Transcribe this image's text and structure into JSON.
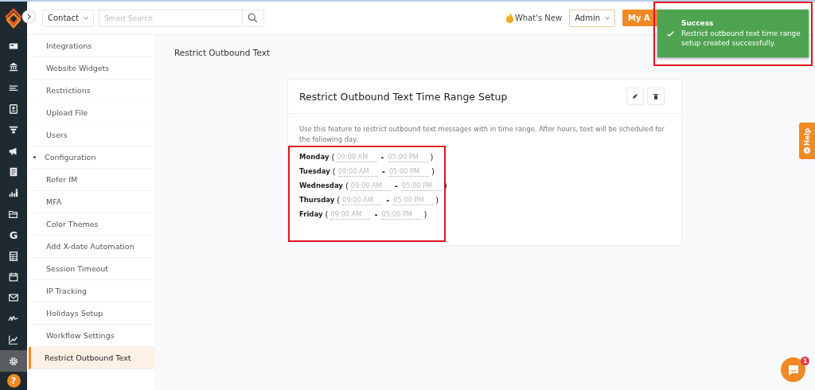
{
  "rail": {
    "items": [
      {
        "kind": "id-card",
        "selected": false
      },
      {
        "kind": "bank",
        "selected": false
      },
      {
        "kind": "list",
        "selected": false
      },
      {
        "kind": "contact",
        "selected": false
      },
      {
        "kind": "funnel",
        "selected": false
      },
      {
        "kind": "megaphone",
        "selected": false
      },
      {
        "kind": "document",
        "selected": false
      },
      {
        "kind": "people-chart",
        "selected": false
      },
      {
        "kind": "folder",
        "selected": false
      },
      {
        "kind": "letter",
        "glyph": "G",
        "selected": false
      },
      {
        "kind": "table",
        "selected": false
      },
      {
        "kind": "calendar",
        "selected": false
      },
      {
        "kind": "mail",
        "selected": false
      },
      {
        "kind": "signature",
        "selected": false
      },
      {
        "kind": "line-chart",
        "selected": false
      },
      {
        "kind": "settings",
        "selected": true
      }
    ],
    "help_glyph": "?"
  },
  "header": {
    "module": "Contact",
    "search": {
      "placeholder": "Smart Search"
    },
    "whats_new": "What's New",
    "role": "Admin",
    "account_button": "My A"
  },
  "sidebar": {
    "items": [
      {
        "kind": "link",
        "label": "Integrations",
        "selected": false
      },
      {
        "kind": "link",
        "label": "Website Widgets",
        "selected": false
      },
      {
        "kind": "link",
        "label": "Restrictions",
        "selected": false
      },
      {
        "kind": "link",
        "label": "Upload File",
        "selected": false
      },
      {
        "kind": "link",
        "label": "Users",
        "selected": false
      },
      {
        "kind": "group",
        "label": "Configuration",
        "selected": false
      },
      {
        "kind": "link",
        "label": "Refer IM",
        "selected": false
      },
      {
        "kind": "link",
        "label": "MFA",
        "selected": false
      },
      {
        "kind": "link",
        "label": "Color Themes",
        "selected": false
      },
      {
        "kind": "link",
        "label": "Add X-date Automation",
        "selected": false
      },
      {
        "kind": "link",
        "label": "Session Timeout",
        "selected": false
      },
      {
        "kind": "link",
        "label": "IP Tracking",
        "selected": false
      },
      {
        "kind": "link",
        "label": "Holidays Setup",
        "selected": false
      },
      {
        "kind": "link",
        "label": "Workflow Settings",
        "selected": false
      },
      {
        "kind": "link",
        "label": "Restrict Outbound Text",
        "selected": true
      }
    ]
  },
  "page_title": "Restrict Outbound Text",
  "card": {
    "title": "Restrict Outbound Text Time Range Setup",
    "description": "Use this feature to restrict outbound text messages with in time range. After hours, text will be scheduled for the following day.",
    "days": [
      {
        "day": "Monday",
        "open": "(",
        "start_placeholder": "09:00 AM",
        "dash": "-",
        "end_placeholder": "05:00 PM",
        "close": ")"
      },
      {
        "day": "Tuesday",
        "open": "(",
        "start_placeholder": "09:00 AM",
        "dash": "-",
        "end_placeholder": "05:00 PM",
        "close": ")"
      },
      {
        "day": "Wednesday",
        "open": "(",
        "start_placeholder": "09:00 AM",
        "dash": "-",
        "end_placeholder": "05:00 PM",
        "close": ")"
      },
      {
        "day": "Thursday",
        "open": "(",
        "start_placeholder": "09:00 AM",
        "dash": "-",
        "end_placeholder": "05:00 PM",
        "close": ")"
      },
      {
        "day": "Friday",
        "open": "(",
        "start_placeholder": "09:00 AM",
        "dash": "-",
        "end_placeholder": "05:00 PM",
        "close": ")"
      }
    ]
  },
  "toast": {
    "title": "Success",
    "message": "Restrict outbound text time range setup created successfully."
  },
  "help_tab": "Help",
  "chat": {
    "badge": "1"
  }
}
